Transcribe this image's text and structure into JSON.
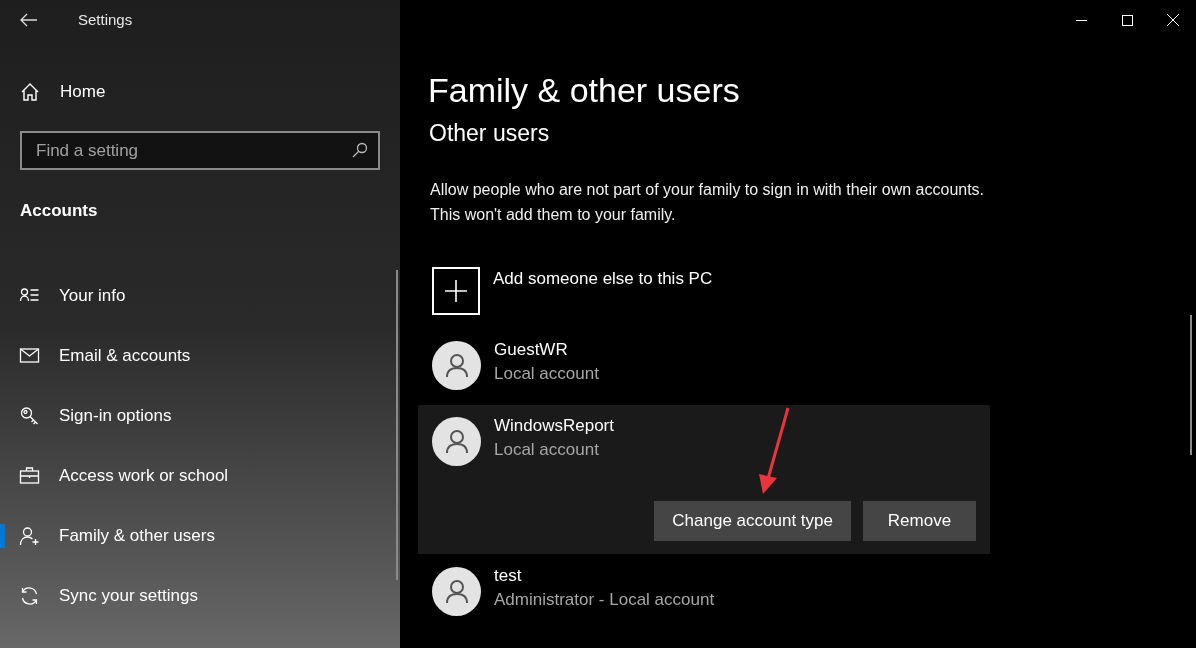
{
  "window": {
    "title": "Settings"
  },
  "sidebar": {
    "home": "Home",
    "search": {
      "placeholder": "Find a setting"
    },
    "section": "Accounts",
    "items": [
      {
        "label": "Your info",
        "kind": "info",
        "selected": false
      },
      {
        "label": "Email & accounts",
        "kind": "mail",
        "selected": false
      },
      {
        "label": "Sign-in options",
        "kind": "key",
        "selected": false
      },
      {
        "label": "Access work or school",
        "kind": "briefcase",
        "selected": false
      },
      {
        "label": "Family & other users",
        "kind": "person-add",
        "selected": true
      },
      {
        "label": "Sync your settings",
        "kind": "sync",
        "selected": false
      }
    ]
  },
  "page": {
    "title": "Family & other users",
    "subtitle": "Other users",
    "description": "Allow people who are not part of your family to sign in with their own accounts. This won't add them to your family.",
    "add_label": "Add someone else to this PC",
    "users": [
      {
        "name": "GuestWR",
        "type": "Local account",
        "expanded": false
      },
      {
        "name": "WindowsReport",
        "type": "Local account",
        "expanded": true,
        "actions": [
          "Change account type",
          "Remove"
        ]
      },
      {
        "name": "test",
        "type": "Administrator - Local account",
        "expanded": false
      }
    ]
  }
}
